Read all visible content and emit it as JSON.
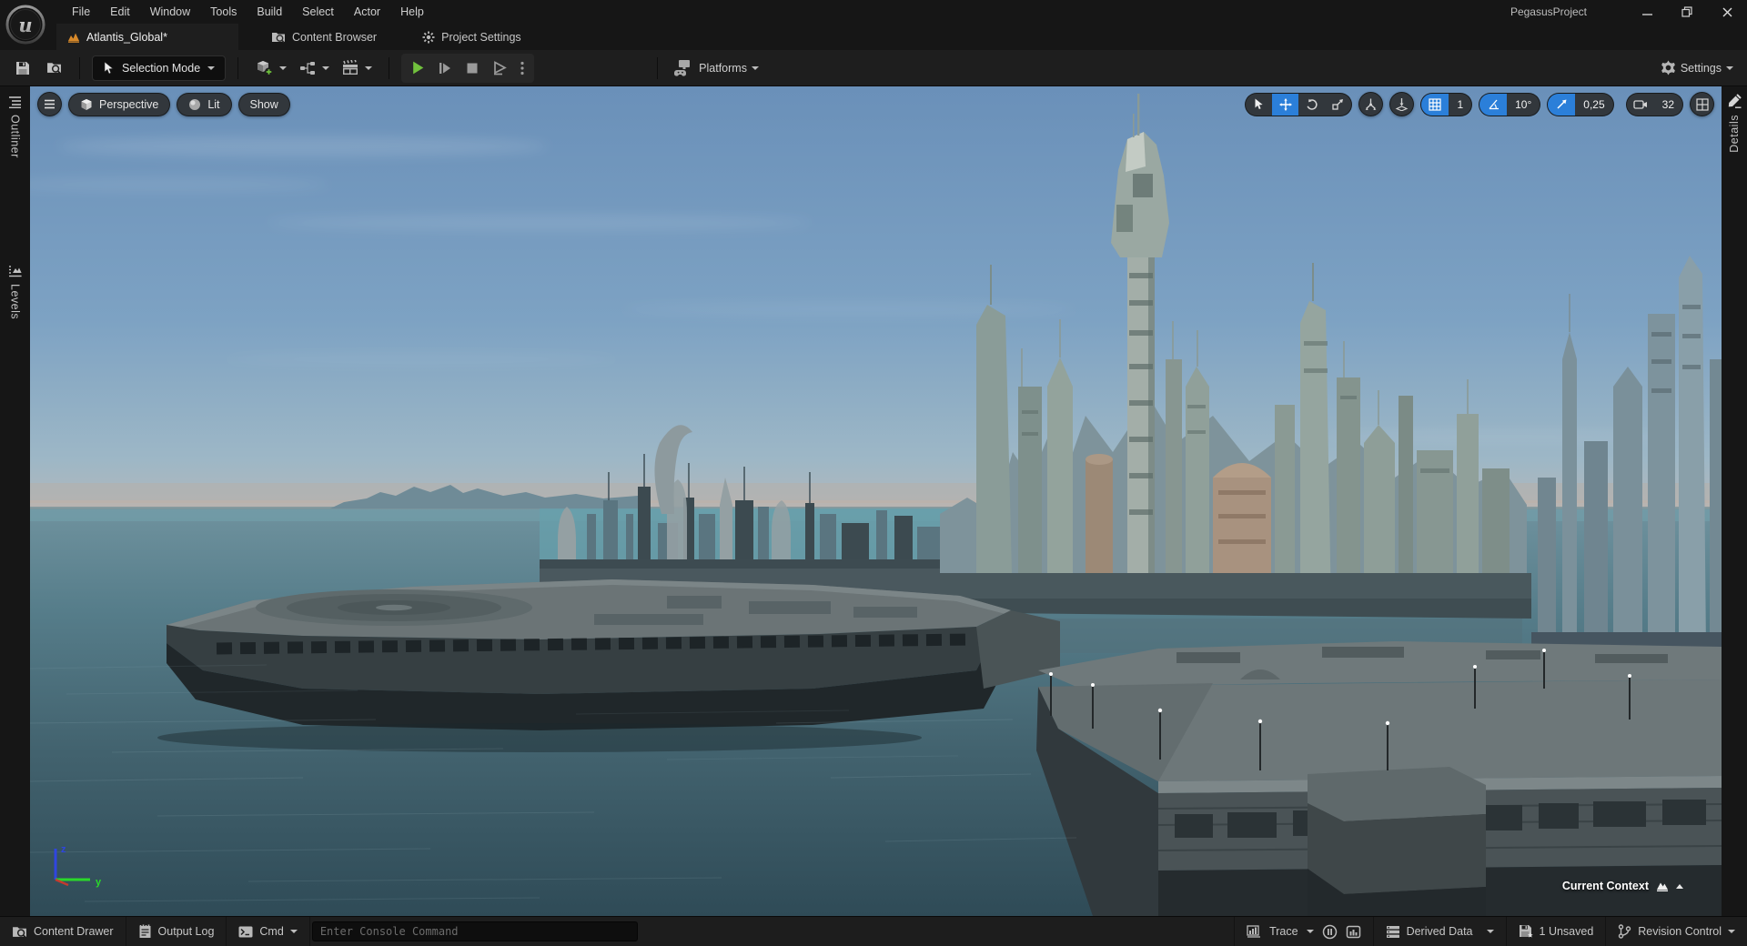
{
  "window": {
    "title": "PegasusProject"
  },
  "menubar": {
    "items": [
      "File",
      "Edit",
      "Window",
      "Tools",
      "Build",
      "Select",
      "Actor",
      "Help"
    ]
  },
  "tabs": {
    "active_label": "Atlantis_Global*",
    "content_browser": "Content Browser",
    "project_settings": "Project Settings"
  },
  "toolbar": {
    "selection_mode": "Selection Mode",
    "platforms": "Platforms",
    "settings": "Settings"
  },
  "viewport": {
    "perspective": "Perspective",
    "lit": "Lit",
    "show": "Show",
    "snap": {
      "grid_value": "1",
      "angle_value": "10°",
      "scale_value": "0,25",
      "camera_speed": "32"
    },
    "current_context": "Current Context",
    "axis": {
      "up": "z",
      "right": "y"
    }
  },
  "side_tabs": {
    "outliner": "Outliner",
    "levels": "Levels",
    "details": "Details"
  },
  "statusbar": {
    "content_drawer": "Content Drawer",
    "output_log": "Output Log",
    "cmd": "Cmd",
    "console_placeholder": "Enter Console Command",
    "trace": "Trace",
    "derived_data": "Derived Data",
    "unsaved": "1 Unsaved",
    "revision_control": "Revision Control"
  },
  "colors": {
    "accent_blue": "#2b7fd9",
    "play_green": "#71c13d",
    "tab_icon_orange": "#d7892a",
    "axis_z_blue": "#2f45e0",
    "axis_y_green": "#2ad82a",
    "axis_x_red": "#c43b2e"
  }
}
